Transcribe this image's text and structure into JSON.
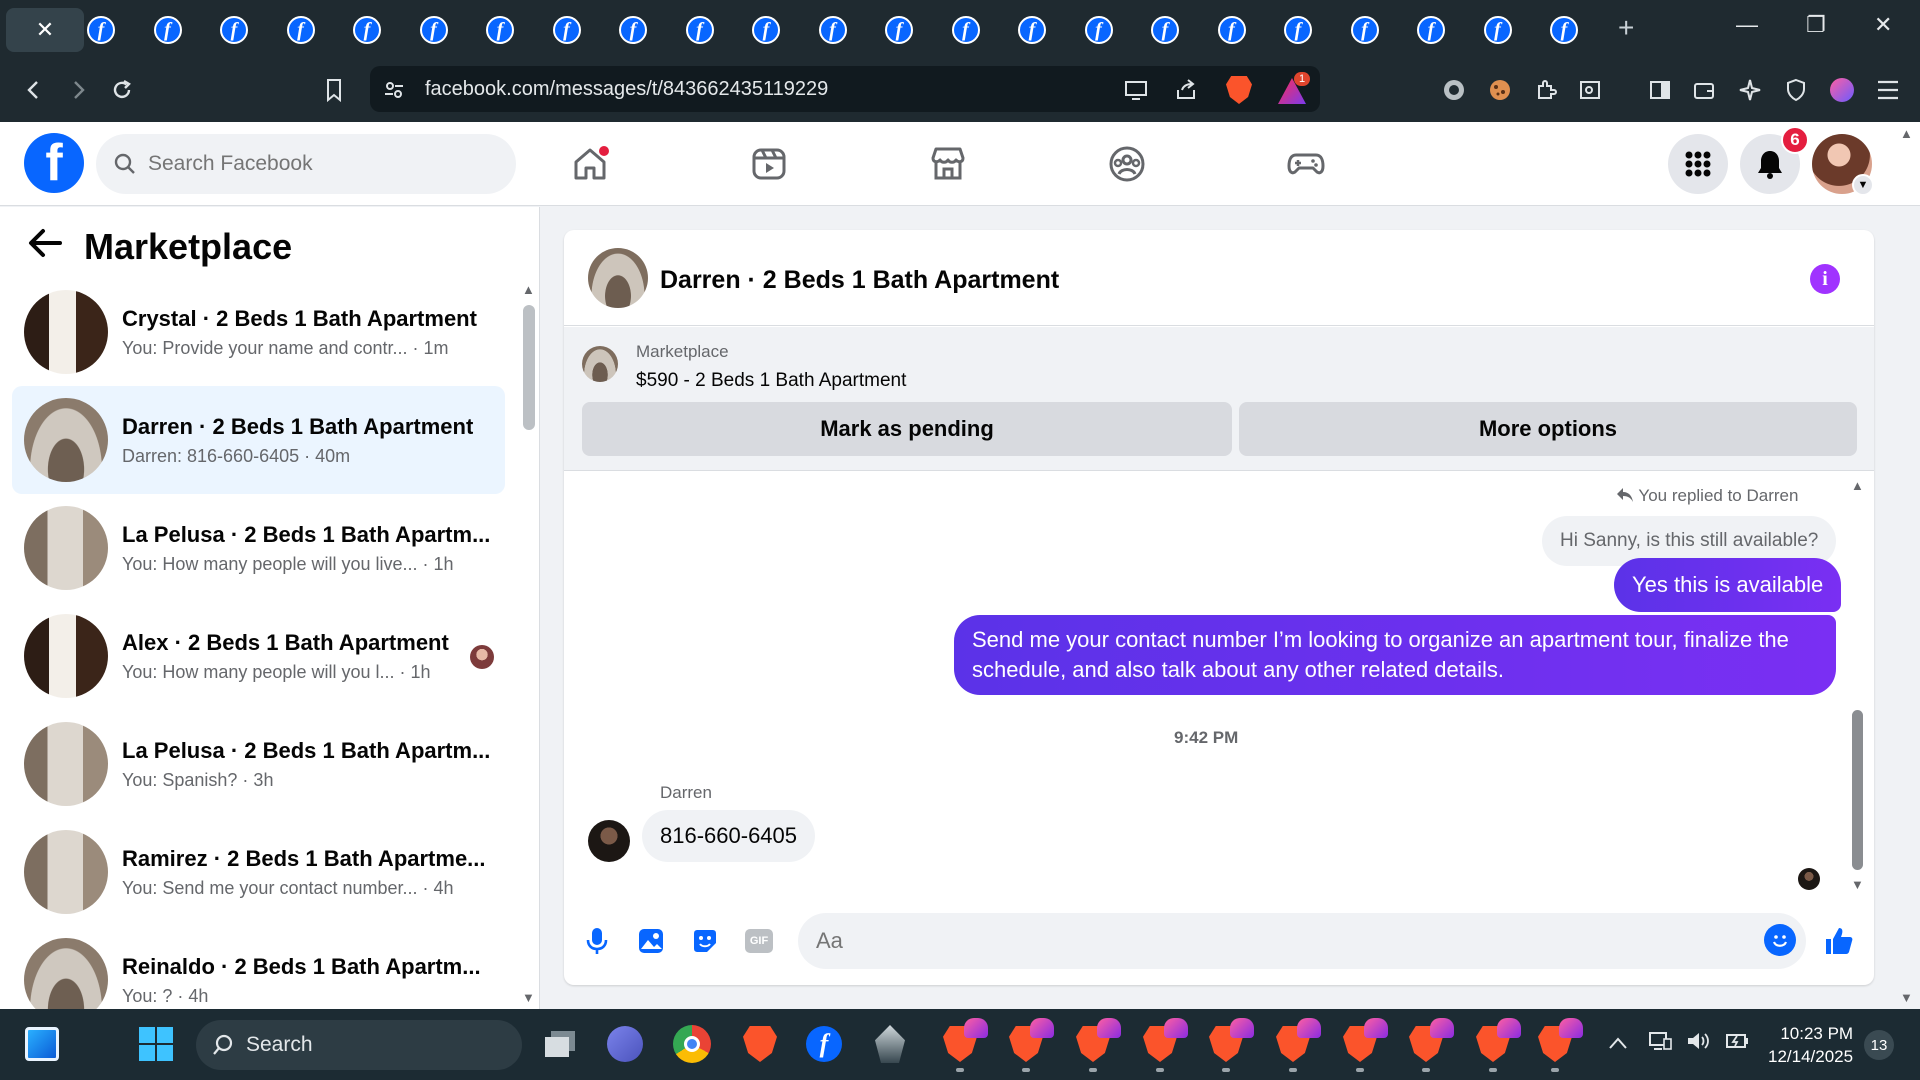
{
  "browser": {
    "active_tab_close": "✕",
    "new_tab": "+",
    "url": "facebook.com/messages/t/843662435119229",
    "rewards_badge": "1",
    "window_controls": {
      "minimize": "—",
      "restore": "❐",
      "close": "✕"
    }
  },
  "header": {
    "logo": "f",
    "search_placeholder": "Search Facebook",
    "notifications_count": "6"
  },
  "sidebar": {
    "title": "Marketplace",
    "conversations": [
      {
        "name": "Crystal · 2 Beds 1 Bath Apartment",
        "preview": "You: Provide your name and contr... · 1m",
        "thumb": "thumb-dark"
      },
      {
        "name": "Darren · 2 Beds 1 Bath Apartment",
        "preview": "Darren: 816-660-6405 · 40m",
        "thumb": "thumb-room"
      },
      {
        "name": "La Pelusa · 2 Beds 1 Bath Apartm...",
        "preview": "You: How many people will you live... · 1h",
        "thumb": "thumb-room2"
      },
      {
        "name": "Alex · 2 Beds 1 Bath Apartment",
        "preview": "You: How many people will you l... · 1h",
        "thumb": "thumb-dark"
      },
      {
        "name": "La Pelusa · 2 Beds 1 Bath Apartm...",
        "preview": "You: Spanish? · 3h",
        "thumb": "thumb-room2"
      },
      {
        "name": "Ramirez · 2 Beds 1 Bath Apartme...",
        "preview": "You: Send me your contact number... · 4h",
        "thumb": "thumb-room2"
      },
      {
        "name": "Reinaldo · 2 Beds 1 Bath Apartm...",
        "preview": "You: ? · 4h",
        "thumb": "thumb-room"
      }
    ]
  },
  "chat": {
    "title": "Darren · 2 Beds 1 Bath Apartment",
    "marketplace_label": "Marketplace",
    "listing": "$590 - 2 Beds 1 Bath Apartment",
    "mark_pending": "Mark as pending",
    "more_options": "More options",
    "reply_note": "You replied to Darren",
    "quoted_message": "Hi Sanny, is this still available?",
    "outgoing_1": "Yes this is available",
    "outgoing_2": "Send me your contact number I’m looking to organize an apartment tour, finalize the schedule, and also talk about any other related details.",
    "timestamp": "9:42 PM",
    "incoming_sender": "Darren",
    "incoming_message": "816-660-6405",
    "composer_placeholder": "Aa"
  },
  "taskbar": {
    "search_label": "Search",
    "time": "10:23 PM",
    "date": "12/14/2025",
    "notification_count": "13"
  }
}
